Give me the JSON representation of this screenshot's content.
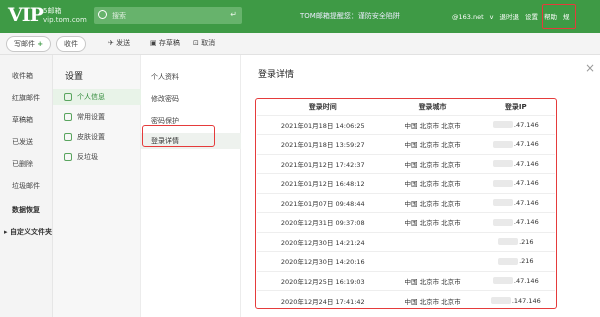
{
  "header": {
    "logo_main": "VIP",
    "logo_cn": "5邮箱",
    "logo_domain": "vip.tom.com",
    "search_placeholder": "搜索",
    "notice": "TOM邮箱提醒您：谨防安全陷阱",
    "account": "@163.net",
    "account_caret": "v",
    "links": [
      "退时退",
      "设置",
      "帮助",
      "规"
    ],
    "colors": {
      "bar": "#3e9a45",
      "highlight": "#e53b3b"
    }
  },
  "toolbar": {
    "write_label": "写邮件",
    "write_icon": "plus-icon",
    "receive_label": "收件",
    "send_label": "发送",
    "draft_label": "存草稿",
    "cancel_label": "取消"
  },
  "leftnav": [
    "收件箱",
    "红旗邮件",
    "草稿箱",
    "已发送",
    "已删除",
    "垃圾邮件",
    "数据恢复",
    "▸ 自定义文件夹"
  ],
  "settings": {
    "title": "设置",
    "items": [
      {
        "label": "个人信息",
        "icon": "person-icon"
      },
      {
        "label": "常用设置",
        "icon": "gear-icon"
      },
      {
        "label": "皮肤设置",
        "icon": "skin-icon"
      },
      {
        "label": "反垃圾",
        "icon": "shield-icon"
      }
    ]
  },
  "subnav": [
    "个人资料",
    "修改密码",
    "密码保护",
    "登录详情"
  ],
  "content": {
    "title": "登录详情",
    "close_label": "×",
    "headers": [
      "登录时间",
      "登录城市",
      "登录IP"
    ],
    "rows": [
      {
        "time": "2021年01月18日 14:06:25",
        "city": "中国 北京市 北京市",
        "ip": ".47.146"
      },
      {
        "time": "2021年01月18日 13:59:27",
        "city": "中国 北京市 北京市",
        "ip": ".47.146"
      },
      {
        "time": "2021年01月12日 17:42:37",
        "city": "中国 北京市 北京市",
        "ip": ".47.146"
      },
      {
        "time": "2021年01月12日 16:48:12",
        "city": "中国 北京市 北京市",
        "ip": ".47.146"
      },
      {
        "time": "2021年01月07日 09:48:44",
        "city": "中国 北京市 北京市",
        "ip": ".47.146"
      },
      {
        "time": "2020年12月31日 09:37:08",
        "city": "中国 北京市 北京市",
        "ip": ".47.146"
      },
      {
        "time": "2020年12月30日 14:21:24",
        "city": "",
        "ip": ".216"
      },
      {
        "time": "2020年12月30日 14:20:16",
        "city": "",
        "ip": ".216"
      },
      {
        "time": "2020年12月25日 16:19:03",
        "city": "中国 北京市 北京市",
        "ip": ".47.146"
      },
      {
        "time": "2020年12月24日 17:41:42",
        "city": "中国 北京市 北京市",
        "ip": ".147.146"
      }
    ]
  }
}
